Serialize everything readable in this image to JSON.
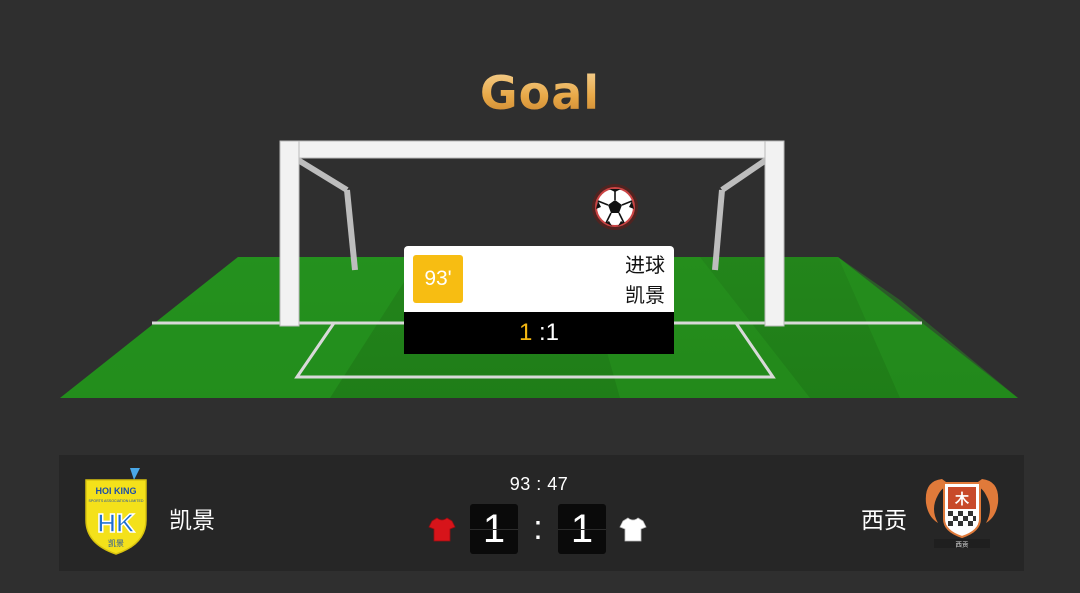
{
  "header": {
    "title": "Goal"
  },
  "event": {
    "minute": "93'",
    "type": "进球",
    "team": "凯景",
    "score_home": "1",
    "score_sep_away": " :1"
  },
  "match": {
    "clock": "93 : 47",
    "home": {
      "name": "凯景",
      "score": "1",
      "shirt_color": "#d7141a",
      "badge_text": "HOI KING",
      "badge_sub": "SPORTS ASSOCIATION LIMITED",
      "badge_cn": "凯景"
    },
    "away": {
      "name": "西贡",
      "score": "1",
      "shirt_color": "#ffffff",
      "badge_cn": "西贡"
    },
    "separator": ":"
  },
  "colors": {
    "accent": "#f7bd12",
    "title_gold": "#e8a948",
    "pitch_green": "#2a9a22",
    "background": "#2f2f2f",
    "scorebar": "#262626"
  }
}
